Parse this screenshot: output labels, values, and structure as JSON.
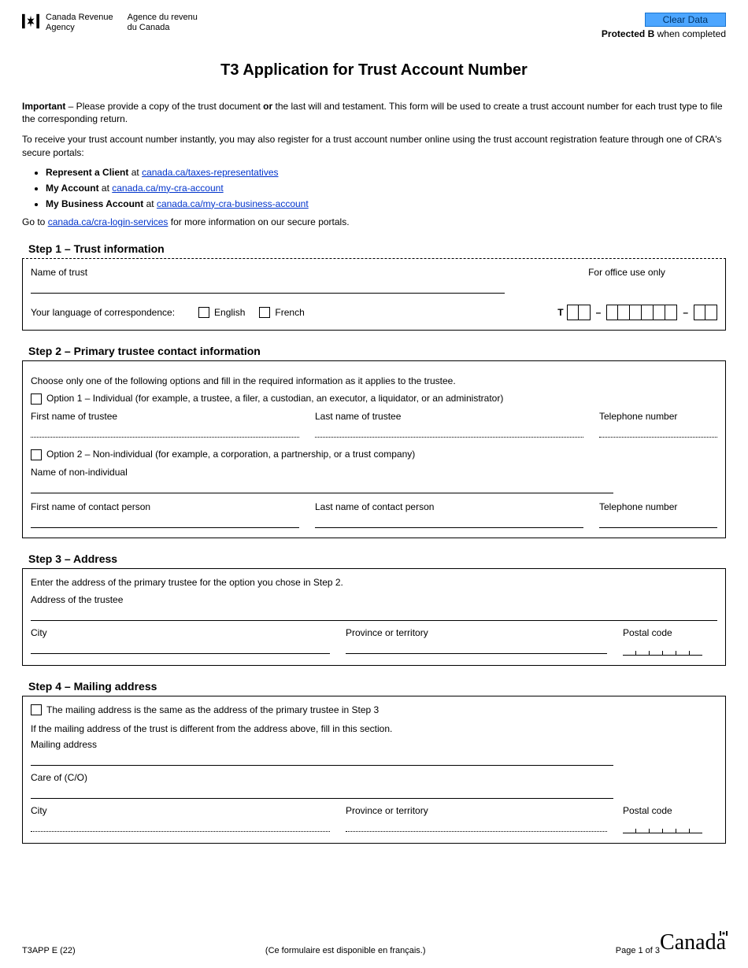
{
  "header": {
    "agency_en_1": "Canada Revenue",
    "agency_en_2": "Agency",
    "agency_fr_1": "Agence du revenu",
    "agency_fr_2": "du Canada",
    "clear_data_label": "Clear Data",
    "protected_prefix": "Protected B",
    "protected_suffix": " when completed"
  },
  "title": "T3 Application for Trust Account Number",
  "intro": {
    "important_label": "Important",
    "important_text": " – Please provide a copy of the trust document ",
    "important_or": "or",
    "important_text2": " the last will and testament. This form will be used to create a trust account number for each trust type to file the corresponding return.",
    "receive_text": "To receive your trust account number instantly, you may also register for a trust account number online using the trust account registration feature through one of CRA's secure portals:"
  },
  "portals": [
    {
      "label": "Represent a Client",
      "at": " at ",
      "url": "canada.ca/taxes-representatives"
    },
    {
      "label": "My Account",
      "at": " at ",
      "url": "canada.ca/my-cra-account"
    },
    {
      "label": "My Business Account",
      "at": " at ",
      "url": "canada.ca/my-cra-business-account"
    }
  ],
  "goto_prefix": "Go to ",
  "goto_url": "canada.ca/cra-login-services",
  "goto_suffix": " for more information on our secure portals.",
  "step1": {
    "heading": "Step 1 – Trust information",
    "name_label": "Name of trust",
    "office_use": "For office use only",
    "lang_label": "Your language of correspondence:",
    "english": "English",
    "french": "French",
    "t_prefix": "T"
  },
  "step2": {
    "heading": "Step 2 – Primary trustee contact information",
    "choose_text": "Choose only one of the following options and fill in the required information as it applies to the trustee.",
    "opt1_label": "Option 1 – Individual (for example, a trustee, a filer, a custodian, an executor, a liquidator, or an administrator)",
    "first_name_trustee": "First name of trustee",
    "last_name_trustee": "Last name of trustee",
    "telephone": "Telephone number",
    "opt2_label": "Option 2 – Non-individual (for example, a corporation, a partnership, or a trust company)",
    "name_nonind": "Name of non-individual",
    "first_contact": "First name of contact person",
    "last_contact": "Last name of contact person"
  },
  "step3": {
    "heading": "Step 3 – Address",
    "enter_text": "Enter the address of the primary trustee for the option you chose in Step 2.",
    "address_label": "Address of the trustee",
    "city": "City",
    "province": "Province or territory",
    "postal": "Postal code"
  },
  "step4": {
    "heading": "Step 4 – Mailing address",
    "same_label": "The mailing address is the same as the address of the primary trustee in Step 3",
    "diff_text": "If the mailing address of the trust is different from the address above, fill in this section.",
    "mailing_label": "Mailing address",
    "careof": "Care of (C/O)",
    "city": "City",
    "province": "Province or territory",
    "postal": "Postal code"
  },
  "footer": {
    "form_code": "T3APP E (22)",
    "french_note": "(Ce formulaire est disponible en français.)",
    "page": "Page 1 of 3",
    "wordmark": "Canada"
  }
}
